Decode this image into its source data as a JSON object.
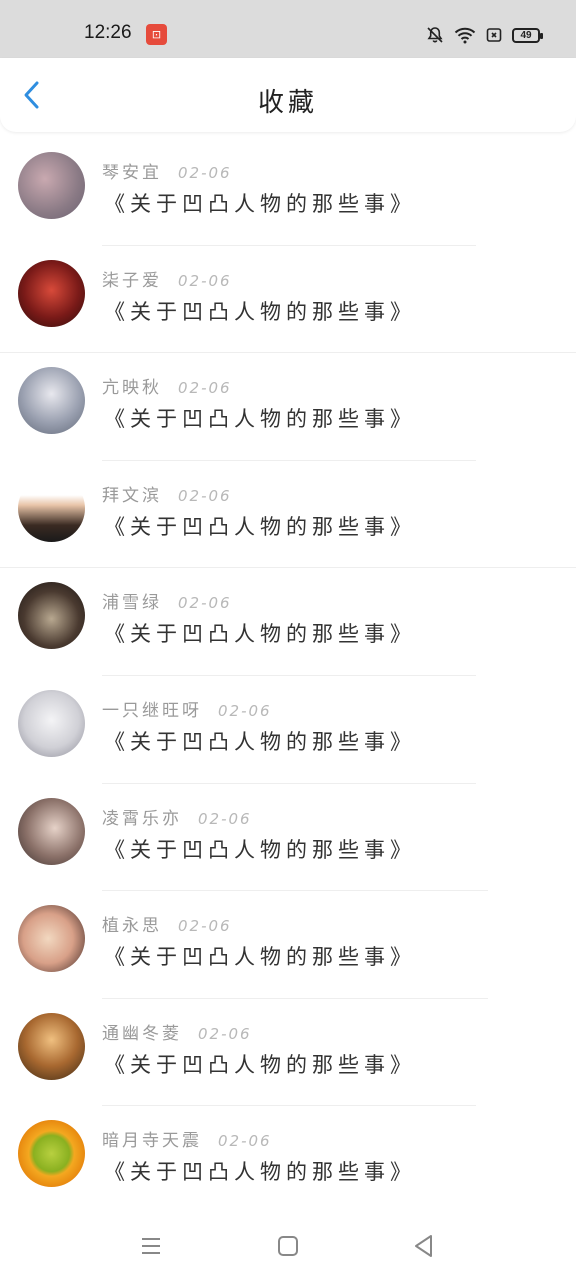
{
  "status_bar": {
    "time": "12:26",
    "battery": "49",
    "icons": [
      "mute-bell-icon",
      "wifi-icon",
      "sim-icon",
      "battery-icon"
    ]
  },
  "header": {
    "title": "收藏",
    "back_icon": "chevron-left-icon"
  },
  "colors": {
    "accent": "#2f8ee0",
    "status_bg": "#dcdcdc",
    "text_primary": "#333333",
    "text_secondary": "#9a9a9a"
  },
  "favorites": [
    {
      "user": "琴安宜",
      "date": "02-06",
      "title": "《关于凹凸人物的那些事》"
    },
    {
      "user": "柒子爱",
      "date": "02-06",
      "title": "《关于凹凸人物的那些事》"
    },
    {
      "user": "亢映秋",
      "date": "02-06",
      "title": "《关于凹凸人物的那些事》"
    },
    {
      "user": "拜文滨",
      "date": "02-06",
      "title": "《关于凹凸人物的那些事》"
    },
    {
      "user": "浦雪绿",
      "date": "02-06",
      "title": "《关于凹凸人物的那些事》"
    },
    {
      "user": "一只继旺呀",
      "date": "02-06",
      "title": "《关于凹凸人物的那些事》"
    },
    {
      "user": "凌霄乐亦",
      "date": "02-06",
      "title": "《关于凹凸人物的那些事》"
    },
    {
      "user": "植永思",
      "date": "02-06",
      "title": "《关于凹凸人物的那些事》"
    },
    {
      "user": "通幽冬菱",
      "date": "02-06",
      "title": "《关于凹凸人物的那些事》"
    },
    {
      "user": "暗月寺天震",
      "date": "02-06",
      "title": "《关于凹凸人物的那些事》"
    }
  ],
  "nav_bar": {
    "icons": [
      "menu-icon",
      "home-square-icon",
      "back-triangle-icon"
    ]
  }
}
